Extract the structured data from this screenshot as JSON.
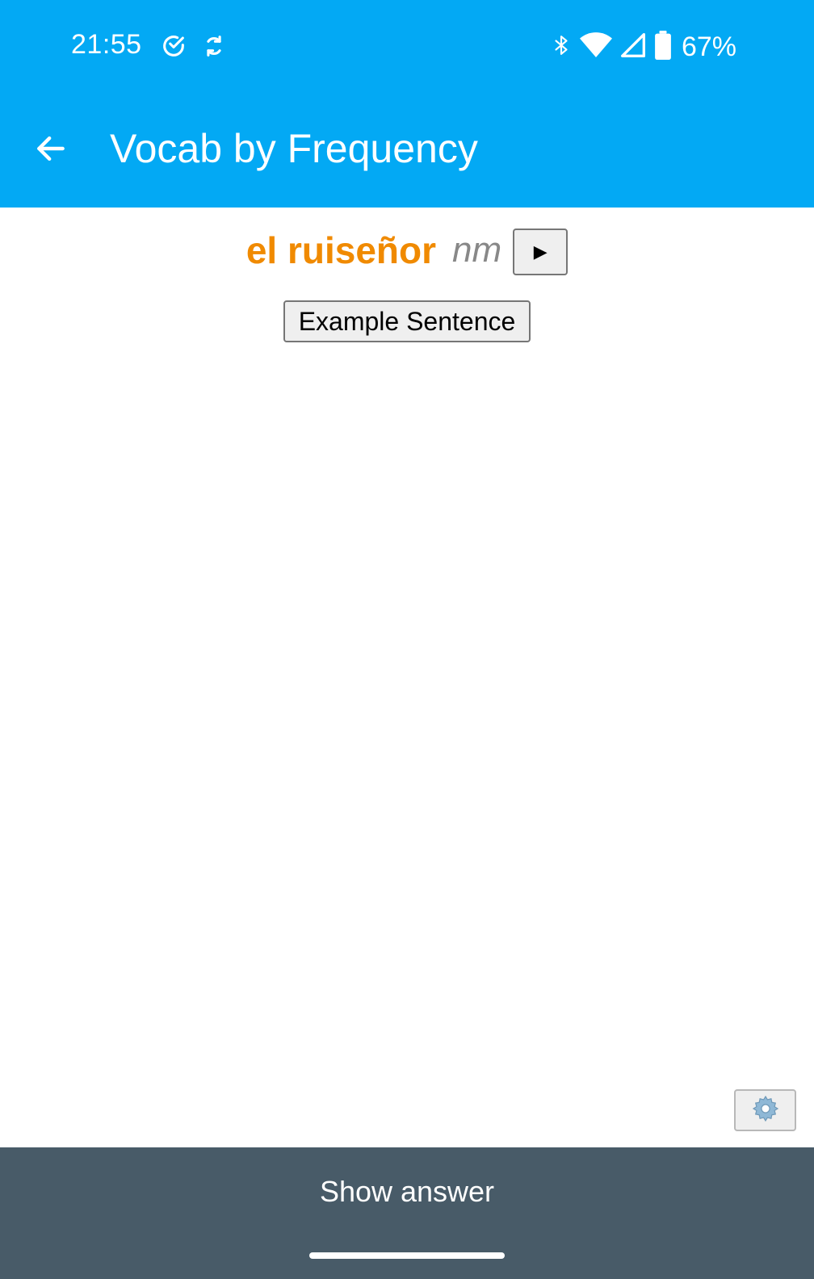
{
  "status_bar": {
    "time": "21:55",
    "battery": "67%",
    "icons": [
      "check-circle-icon",
      "sync-icon",
      "bluetooth-icon",
      "wifi-icon",
      "cellular-signal-icon",
      "battery-icon"
    ]
  },
  "app_bar": {
    "title": "Vocab by Frequency",
    "back_icon": "arrow-left-icon"
  },
  "card": {
    "word": "el ruiseñor",
    "part_of_speech": "nm",
    "play_label": "▶",
    "example_button_label": "Example Sentence",
    "settings_icon": "gear-icon"
  },
  "bottom_bar": {
    "show_answer_label": "Show answer"
  },
  "colors": {
    "primary": "#03a9f4",
    "word": "#f08a00",
    "bottom_bar": "#485b68"
  }
}
